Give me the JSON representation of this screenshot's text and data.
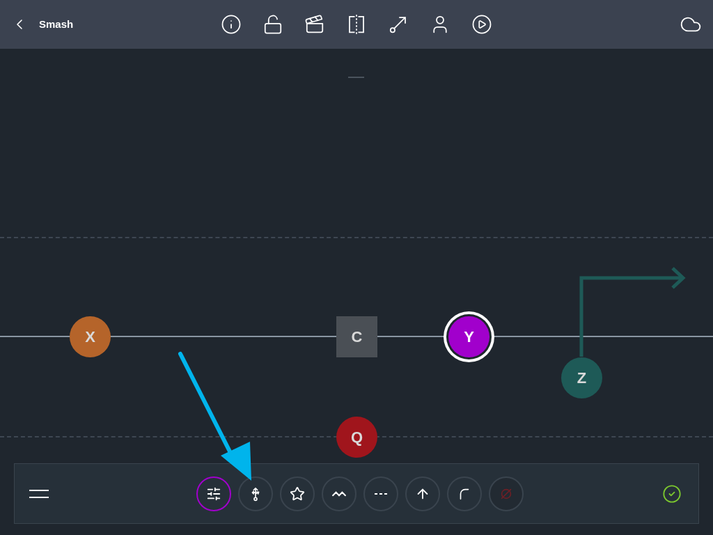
{
  "header": {
    "title": "Smash"
  },
  "players": [
    {
      "label": "X",
      "color": "#b5642a",
      "kind": "circle",
      "selected": false
    },
    {
      "label": "C",
      "color": "#4a4f55",
      "kind": "square",
      "selected": false
    },
    {
      "label": "Y",
      "color": "#a100cc",
      "kind": "circle",
      "selected": true
    },
    {
      "label": "Z",
      "color": "#1e5a57",
      "kind": "circle",
      "selected": false
    },
    {
      "label": "Q",
      "color": "#a0151c",
      "kind": "circle",
      "selected": false
    }
  ],
  "toolbar": {
    "tools": [
      {
        "kind": "settings",
        "selected": true,
        "disabled": false
      },
      {
        "kind": "route",
        "selected": false,
        "disabled": false
      },
      {
        "kind": "star",
        "selected": false,
        "disabled": false
      },
      {
        "kind": "zigzag",
        "selected": false,
        "disabled": false
      },
      {
        "kind": "dashed",
        "selected": false,
        "disabled": false
      },
      {
        "kind": "arrow",
        "selected": false,
        "disabled": false
      },
      {
        "kind": "curve",
        "selected": false,
        "disabled": false
      },
      {
        "kind": "none",
        "selected": false,
        "disabled": true
      }
    ]
  }
}
